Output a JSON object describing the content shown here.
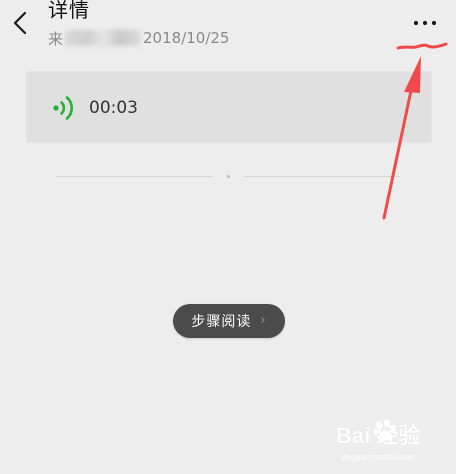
{
  "header": {
    "back_icon": "chevron-left-icon",
    "title": "详情",
    "source_prefix": "来",
    "date": "2018/10/25",
    "more_icon": "more-horizontal-icon"
  },
  "voice_message": {
    "icon": "voice-wave-icon",
    "duration": "00:03",
    "accent_color": "#2aae3a"
  },
  "step_read": {
    "label": "步骤阅读",
    "chevron": "›"
  },
  "annotation": {
    "color": "#f24a4a"
  },
  "watermark": {
    "brand": "Bai 经验",
    "site": "jingyan.baidu.com"
  }
}
